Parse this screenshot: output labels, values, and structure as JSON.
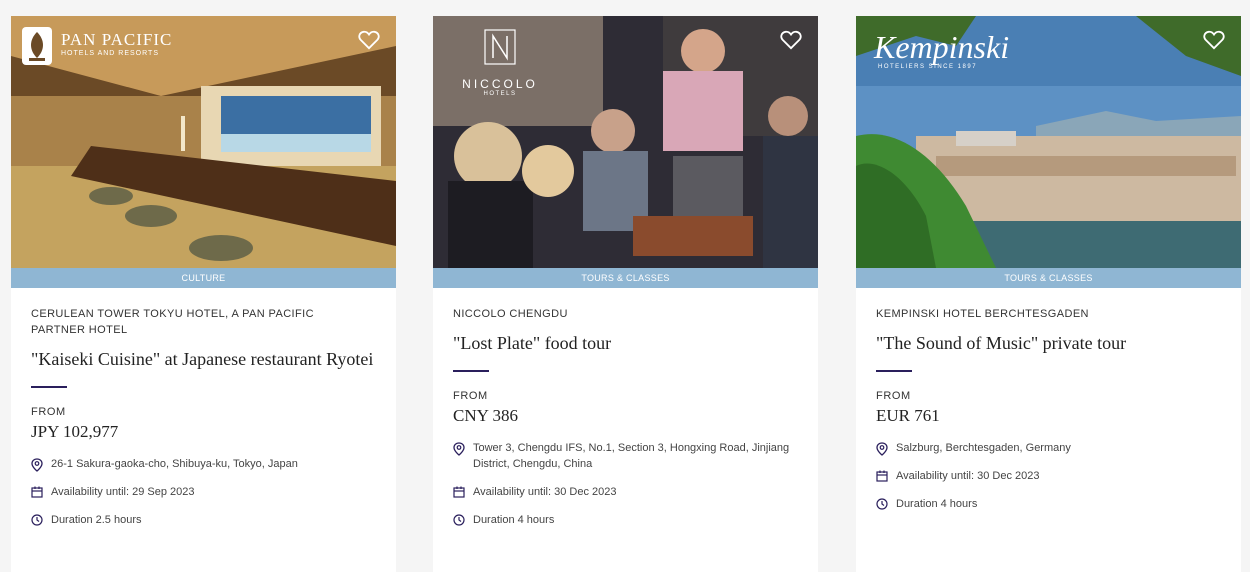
{
  "colors": {
    "accent": "#2a1f5c",
    "category_bar": "#8fb6d3",
    "page_bg": "#f5f5f5"
  },
  "cards": [
    {
      "logo_name": "PAN PACIFIC",
      "logo_sub": "HOTELS AND RESORTS",
      "category": "CULTURE",
      "hotel": "CERULEAN TOWER TOKYU HOTEL, A PAN PACIFIC PARTNER HOTEL",
      "title": "\"Kaiseki Cuisine\" at Japanese restaurant Ryotei",
      "from_label": "FROM",
      "price": "JPY 102,977",
      "address": "26-1 Sakura-gaoka-cho, Shibuya-ku, Tokyo, Japan",
      "availability": "Availability until: 29 Sep 2023",
      "duration": "Duration 2.5 hours"
    },
    {
      "logo_name": "NICCOLO",
      "logo_sub": "HOTELS",
      "category": "TOURS & CLASSES",
      "hotel": "NICCOLO CHENGDU",
      "title": "\"Lost Plate\" food tour",
      "from_label": "FROM",
      "price": "CNY 386",
      "address": "Tower 3, Chengdu IFS, No.1, Section 3, Hongxing Road, Jinjiang District, Chengdu, China",
      "availability": "Availability until: 30 Dec 2023",
      "duration": "Duration 4 hours"
    },
    {
      "logo_name": "Kempinski",
      "logo_sub": "HOTELIERS SINCE 1897",
      "category": "TOURS & CLASSES",
      "hotel": "KEMPINSKI HOTEL BERCHTESGADEN",
      "title": "\"The Sound of Music\" private tour",
      "from_label": "FROM",
      "price": "EUR 761",
      "address": "Salzburg, Berchtesgaden, Germany",
      "availability": "Availability until: 30 Dec 2023",
      "duration": "Duration 4 hours"
    }
  ]
}
